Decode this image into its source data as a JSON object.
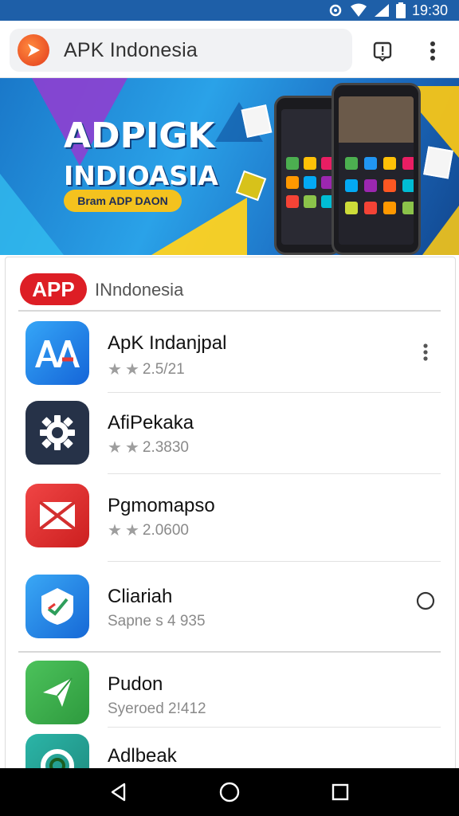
{
  "status_bar": {
    "time": "19:30"
  },
  "app_bar": {
    "title": "APK Indonesia"
  },
  "banner": {
    "title": "ADPIGK",
    "subtitle": "INDIOASIA",
    "pill": "Bram ADP DAON"
  },
  "list": {
    "badge": "APP",
    "heading": "INndonesia",
    "items": [
      {
        "name": "ApK Indanjpal",
        "meta": "2.5/21",
        "stars": true,
        "icon": "aa-app-icon",
        "color": "#1e88e5"
      },
      {
        "name": "AfiPekaka",
        "meta": "2.3830",
        "stars": true,
        "icon": "gear-app-icon",
        "color": "#263248"
      },
      {
        "name": "Pgmomapso",
        "meta": "2.0600",
        "stars": true,
        "icon": "mail-app-icon",
        "color": "#e53935"
      },
      {
        "name": "Cliariah",
        "meta": "Sapne s 4 935",
        "stars": false,
        "icon": "shield-app-icon",
        "color": "#1e88e5"
      },
      {
        "name": "Pudon",
        "meta": "Syeroed 2!412",
        "stars": false,
        "icon": "send-app-icon",
        "color": "#43a047"
      },
      {
        "name": "Adlbeak",
        "meta": "",
        "stars": false,
        "icon": "ring-app-icon",
        "color": "#26a69a"
      }
    ]
  },
  "colors": {
    "status_bar": "#1e5fa8",
    "badge_red": "#dd1e25",
    "banner_yellow": "#f4c21e"
  }
}
